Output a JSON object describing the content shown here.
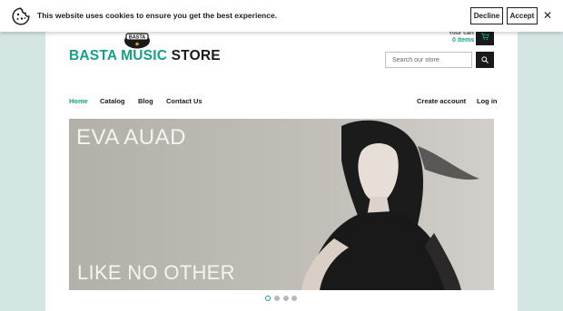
{
  "cookie_banner": {
    "message": "This website uses cookies to ensure you get the best experience.",
    "decline_label": "Decline",
    "accept_label": "Accept",
    "close_glyph": "✕",
    "icon": "cookie-icon"
  },
  "header": {
    "cart": {
      "label": "Your cart",
      "count_text": "0 items",
      "icon": "cart-icon"
    },
    "logo": {
      "badge_text": "BASTA",
      "name_part1": "BASTA MUSIC",
      "name_part2": "STORE"
    },
    "search": {
      "placeholder": "Search our store",
      "value": "",
      "icon": "search-icon"
    }
  },
  "nav": {
    "links": [
      {
        "label": "Home",
        "active": true
      },
      {
        "label": "Catalog"
      },
      {
        "label": "Blog"
      },
      {
        "label": "Contact Us"
      }
    ],
    "account": {
      "create_label": "Create account",
      "login_label": "Log in"
    }
  },
  "hero": {
    "title": "EVA AUAD",
    "subtitle": "LIKE NO OTHER",
    "slide_count": 4,
    "active_slide": 1
  },
  "colors": {
    "accent": "#16a085",
    "dark": "#1a1a1a",
    "page_bg": "#d4e6e4",
    "hero_bg": "#b4b0aa"
  }
}
